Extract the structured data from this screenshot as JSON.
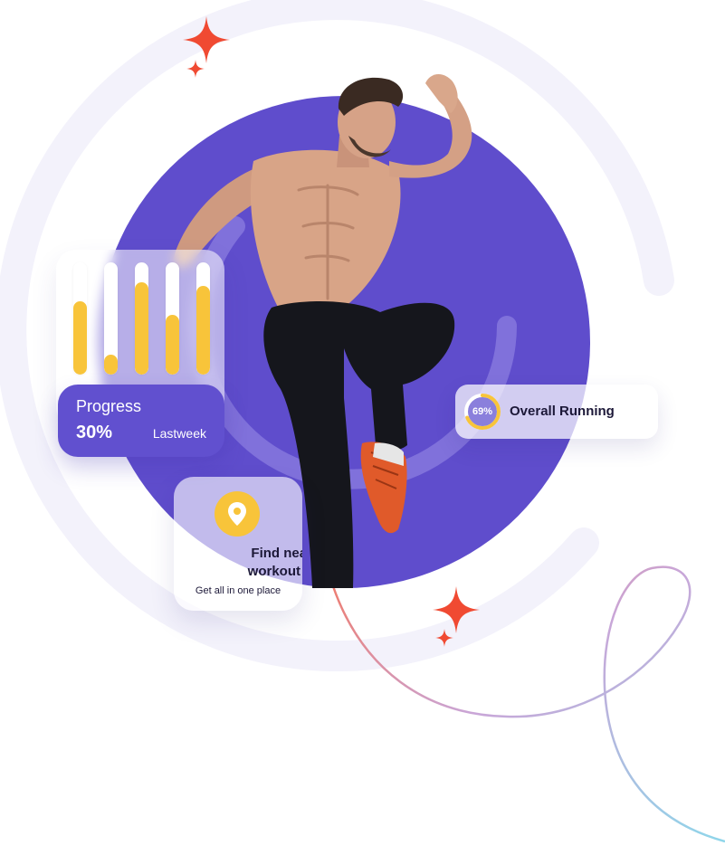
{
  "colors": {
    "purple_circle": "#5f4dcc",
    "purple_dark": "#6150cf",
    "accent_yellow": "#f8c43a",
    "sparkle_red": "#f04a32",
    "ring_lavender": "#f3f2fb"
  },
  "progress_card": {
    "title": "Progress",
    "value": "30%",
    "period": "Lastweek",
    "bars": [
      0.65,
      0.18,
      0.82,
      0.53,
      0.79
    ]
  },
  "running_card": {
    "percent_label": "69%",
    "percent_value": 0.69,
    "label": "Overall Running"
  },
  "location_card": {
    "icon": "location-pin-icon",
    "title": "Find nearest workout zone",
    "subtitle": "Get all in one place"
  },
  "decorations": {
    "sparkle_icon": "sparkle-icon",
    "figure": "running-athlete-illustration"
  }
}
